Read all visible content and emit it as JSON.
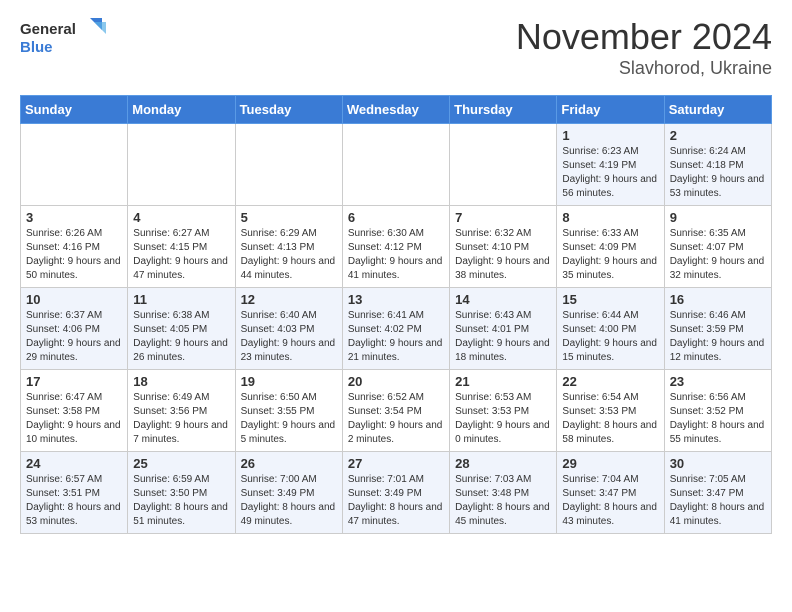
{
  "logo": {
    "line1": "General",
    "line2": "Blue"
  },
  "title": "November 2024",
  "location": "Slavhorod, Ukraine",
  "weekdays": [
    "Sunday",
    "Monday",
    "Tuesday",
    "Wednesday",
    "Thursday",
    "Friday",
    "Saturday"
  ],
  "weeks": [
    [
      {
        "day": "",
        "info": ""
      },
      {
        "day": "",
        "info": ""
      },
      {
        "day": "",
        "info": ""
      },
      {
        "day": "",
        "info": ""
      },
      {
        "day": "",
        "info": ""
      },
      {
        "day": "1",
        "info": "Sunrise: 6:23 AM\nSunset: 4:19 PM\nDaylight: 9 hours and 56 minutes."
      },
      {
        "day": "2",
        "info": "Sunrise: 6:24 AM\nSunset: 4:18 PM\nDaylight: 9 hours and 53 minutes."
      }
    ],
    [
      {
        "day": "3",
        "info": "Sunrise: 6:26 AM\nSunset: 4:16 PM\nDaylight: 9 hours and 50 minutes."
      },
      {
        "day": "4",
        "info": "Sunrise: 6:27 AM\nSunset: 4:15 PM\nDaylight: 9 hours and 47 minutes."
      },
      {
        "day": "5",
        "info": "Sunrise: 6:29 AM\nSunset: 4:13 PM\nDaylight: 9 hours and 44 minutes."
      },
      {
        "day": "6",
        "info": "Sunrise: 6:30 AM\nSunset: 4:12 PM\nDaylight: 9 hours and 41 minutes."
      },
      {
        "day": "7",
        "info": "Sunrise: 6:32 AM\nSunset: 4:10 PM\nDaylight: 9 hours and 38 minutes."
      },
      {
        "day": "8",
        "info": "Sunrise: 6:33 AM\nSunset: 4:09 PM\nDaylight: 9 hours and 35 minutes."
      },
      {
        "day": "9",
        "info": "Sunrise: 6:35 AM\nSunset: 4:07 PM\nDaylight: 9 hours and 32 minutes."
      }
    ],
    [
      {
        "day": "10",
        "info": "Sunrise: 6:37 AM\nSunset: 4:06 PM\nDaylight: 9 hours and 29 minutes."
      },
      {
        "day": "11",
        "info": "Sunrise: 6:38 AM\nSunset: 4:05 PM\nDaylight: 9 hours and 26 minutes."
      },
      {
        "day": "12",
        "info": "Sunrise: 6:40 AM\nSunset: 4:03 PM\nDaylight: 9 hours and 23 minutes."
      },
      {
        "day": "13",
        "info": "Sunrise: 6:41 AM\nSunset: 4:02 PM\nDaylight: 9 hours and 21 minutes."
      },
      {
        "day": "14",
        "info": "Sunrise: 6:43 AM\nSunset: 4:01 PM\nDaylight: 9 hours and 18 minutes."
      },
      {
        "day": "15",
        "info": "Sunrise: 6:44 AM\nSunset: 4:00 PM\nDaylight: 9 hours and 15 minutes."
      },
      {
        "day": "16",
        "info": "Sunrise: 6:46 AM\nSunset: 3:59 PM\nDaylight: 9 hours and 12 minutes."
      }
    ],
    [
      {
        "day": "17",
        "info": "Sunrise: 6:47 AM\nSunset: 3:58 PM\nDaylight: 9 hours and 10 minutes."
      },
      {
        "day": "18",
        "info": "Sunrise: 6:49 AM\nSunset: 3:56 PM\nDaylight: 9 hours and 7 minutes."
      },
      {
        "day": "19",
        "info": "Sunrise: 6:50 AM\nSunset: 3:55 PM\nDaylight: 9 hours and 5 minutes."
      },
      {
        "day": "20",
        "info": "Sunrise: 6:52 AM\nSunset: 3:54 PM\nDaylight: 9 hours and 2 minutes."
      },
      {
        "day": "21",
        "info": "Sunrise: 6:53 AM\nSunset: 3:53 PM\nDaylight: 9 hours and 0 minutes."
      },
      {
        "day": "22",
        "info": "Sunrise: 6:54 AM\nSunset: 3:53 PM\nDaylight: 8 hours and 58 minutes."
      },
      {
        "day": "23",
        "info": "Sunrise: 6:56 AM\nSunset: 3:52 PM\nDaylight: 8 hours and 55 minutes."
      }
    ],
    [
      {
        "day": "24",
        "info": "Sunrise: 6:57 AM\nSunset: 3:51 PM\nDaylight: 8 hours and 53 minutes."
      },
      {
        "day": "25",
        "info": "Sunrise: 6:59 AM\nSunset: 3:50 PM\nDaylight: 8 hours and 51 minutes."
      },
      {
        "day": "26",
        "info": "Sunrise: 7:00 AM\nSunset: 3:49 PM\nDaylight: 8 hours and 49 minutes."
      },
      {
        "day": "27",
        "info": "Sunrise: 7:01 AM\nSunset: 3:49 PM\nDaylight: 8 hours and 47 minutes."
      },
      {
        "day": "28",
        "info": "Sunrise: 7:03 AM\nSunset: 3:48 PM\nDaylight: 8 hours and 45 minutes."
      },
      {
        "day": "29",
        "info": "Sunrise: 7:04 AM\nSunset: 3:47 PM\nDaylight: 8 hours and 43 minutes."
      },
      {
        "day": "30",
        "info": "Sunrise: 7:05 AM\nSunset: 3:47 PM\nDaylight: 8 hours and 41 minutes."
      }
    ]
  ]
}
